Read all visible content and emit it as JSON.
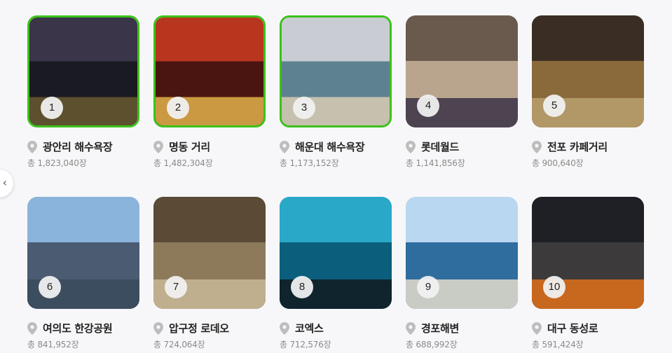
{
  "carousel": {
    "prev_icon": "chevron-left-icon",
    "prev_glyph": "‹",
    "items": [
      {
        "rank": "1",
        "name": "광안리 해수욕장",
        "count": "총 1,823,040장",
        "selected": true,
        "colors": [
          "#3a3548",
          "#1a1a22",
          "#6a5a30"
        ]
      },
      {
        "rank": "2",
        "name": "명동 거리",
        "count": "총 1,482,304장",
        "selected": true,
        "colors": [
          "#b8361e",
          "#4a1410",
          "#e2b04a"
        ]
      },
      {
        "rank": "3",
        "name": "해운대 해수욕장",
        "count": "총 1,173,152장",
        "selected": true,
        "colors": [
          "#c9cdd3",
          "#5e8191",
          "#d8cbb4"
        ]
      },
      {
        "rank": "4",
        "name": "롯데월드",
        "count": "총 1,141,856장",
        "selected": false,
        "colors": [
          "#6a5a4e",
          "#b9a48e",
          "#3a3346"
        ]
      },
      {
        "rank": "5",
        "name": "전포 카페거리",
        "count": "총 900,640장",
        "selected": false,
        "colors": [
          "#3a2e24",
          "#8a6a3a",
          "#b8a070"
        ]
      },
      {
        "rank": "6",
        "name": "여의도 한강공원",
        "count": "총 841,952장",
        "selected": false,
        "colors": [
          "#8bb4dc",
          "#4b5c72",
          "#3a4a5c"
        ]
      },
      {
        "rank": "7",
        "name": "압구정 로데오",
        "count": "총 724,064장",
        "selected": false,
        "colors": [
          "#5a4a36",
          "#8c7a5a",
          "#c8b898"
        ]
      },
      {
        "rank": "8",
        "name": "코엑스",
        "count": "총 712,576장",
        "selected": false,
        "colors": [
          "#2aa8c8",
          "#0b5f7c",
          "#111a20"
        ]
      },
      {
        "rank": "9",
        "name": "경포해변",
        "count": "총 688,992장",
        "selected": false,
        "colors": [
          "#b9d7f0",
          "#2f6d9e",
          "#e4dccb"
        ]
      },
      {
        "rank": "10",
        "name": "대구 동성로",
        "count": "총 591,424장",
        "selected": false,
        "colors": [
          "#1f2026",
          "#3c3a3a",
          "#e0701a"
        ]
      }
    ]
  }
}
